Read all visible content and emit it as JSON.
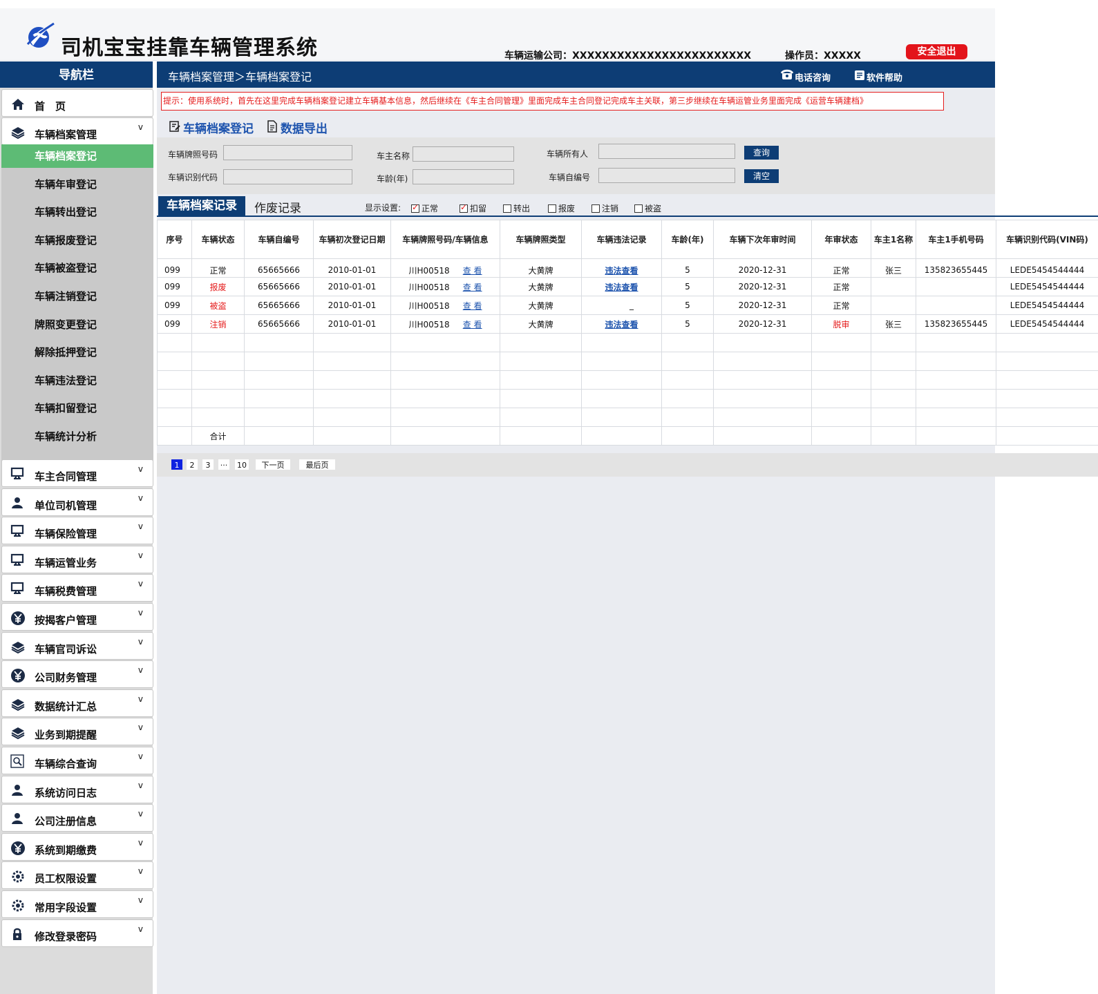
{
  "header": {
    "title": "司机宝宝挂靠车辆管理系统",
    "company": "车辆运输公司：XXXXXXXXXXXXXXXXXXXXXXXX",
    "operator": "操作员：XXXXX",
    "logout": "安全退出"
  },
  "sidebar": {
    "title": "导航栏",
    "home": "首　页",
    "archive_group": "车辆档案管理",
    "sub_items": [
      "车辆档案登记",
      "车辆年审登记",
      "车辆转出登记",
      "车辆报废登记",
      "车辆被盗登记",
      "车辆注销登记",
      "牌照变更登记",
      "解除抵押登记",
      "车辆违法登记",
      "车辆扣留登记",
      "车辆统计分析"
    ],
    "groups": [
      {
        "label": "车主合同管理",
        "icon": "monitor-icon"
      },
      {
        "label": "单位司机管理",
        "icon": "user-icon"
      },
      {
        "label": "车辆保险管理",
        "icon": "monitor-icon"
      },
      {
        "label": "车辆运管业务",
        "icon": "monitor-icon"
      },
      {
        "label": "车辆税费管理",
        "icon": "monitor-icon"
      },
      {
        "label": "按揭客户管理",
        "icon": "yen-icon"
      },
      {
        "label": "车辆官司诉讼",
        "icon": "layers-icon"
      },
      {
        "label": "公司财务管理",
        "icon": "yen-icon"
      },
      {
        "label": "数据统计汇总",
        "icon": "layers-icon"
      },
      {
        "label": "业务到期提醒",
        "icon": "layers-icon"
      },
      {
        "label": "车辆综合查询",
        "icon": "search-doc-icon"
      },
      {
        "label": "系统访问日志",
        "icon": "user-icon"
      },
      {
        "label": "公司注册信息",
        "icon": "user-icon"
      },
      {
        "label": "系统到期缴费",
        "icon": "yen-icon"
      },
      {
        "label": "员工权限设置",
        "icon": "gear-icon"
      },
      {
        "label": "常用字段设置",
        "icon": "gear-icon"
      },
      {
        "label": "修改登录密码",
        "icon": "lock-icon"
      }
    ],
    "chevron": "v"
  },
  "topbar": {
    "breadcrumb": "车辆档案管理＞车辆档案登记",
    "phone": "电话咨询",
    "help": "软件帮助"
  },
  "tip": "提示：使用系统时，首先在这里完成车辆档案登记建立车辆基本信息，然后继续在《车主合同管理》里面完成车主合同登记完成车主关联，第三步继续在车辆运管业务里面完成《运营车辆建档》",
  "actions": {
    "register": "车辆档案登记",
    "export": "数据导出"
  },
  "search": {
    "plate_label": "车辆牌照号码",
    "owner_name_label": "车主名称",
    "vehicle_owner_label": "车辆所有人",
    "vin_label": "车辆识别代码",
    "age_label": "车龄(年)",
    "self_no_label": "车辆自编号",
    "query_button": "查询",
    "clear_button": "清空"
  },
  "tabs": {
    "records": "车辆档案记录",
    "void": "作废记录"
  },
  "display": {
    "label": "显示设置:",
    "options": [
      {
        "label": "正常",
        "checked": true
      },
      {
        "label": "扣留",
        "checked": true
      },
      {
        "label": "转出",
        "checked": false
      },
      {
        "label": "报废",
        "checked": false
      },
      {
        "label": "注销",
        "checked": false
      },
      {
        "label": "被盗",
        "checked": false
      }
    ]
  },
  "table": {
    "headers": [
      "序号",
      "车辆状态",
      "车辆自编号",
      "车辆初次登记日期",
      "车辆牌照号码/车辆信息",
      "车辆牌照类型",
      "车辆违法记录",
      "车龄(年)",
      "车辆下次年审时间",
      "年审状态",
      "车主1名称",
      "车主1手机号码",
      "车辆识别代码(VIN码)"
    ],
    "rows": [
      {
        "no": "099",
        "status": "正常",
        "self_no": "65665666",
        "reg_date": "2010-01-01",
        "plate": "川H00518",
        "view": "查 看",
        "plate_type": "大黄牌",
        "violation": "违法查看",
        "age": "5",
        "next_review": "2020-12-31",
        "review_status": "正常",
        "owner": "张三",
        "phone": "135823655445",
        "vin": "LEDE5454544444"
      },
      {
        "no": "099",
        "status": "报废",
        "self_no": "65665666",
        "reg_date": "2010-01-01",
        "plate": "川H00518",
        "view": "查 看",
        "plate_type": "大黄牌",
        "violation": "违法查看",
        "age": "5",
        "next_review": "2020-12-31",
        "review_status": "正常",
        "owner": "",
        "phone": "",
        "vin": "LEDE5454544444"
      },
      {
        "no": "099",
        "status": "被盗",
        "self_no": "65665666",
        "reg_date": "2010-01-01",
        "plate": "川H00518",
        "view": "查 看",
        "plate_type": "大黄牌",
        "violation": "_",
        "age": "5",
        "next_review": "2020-12-31",
        "review_status": "正常",
        "owner": "",
        "phone": "",
        "vin": "LEDE5454544444"
      },
      {
        "no": "099",
        "status": "注销",
        "self_no": "65665666",
        "reg_date": "2010-01-01",
        "plate": "川H00518",
        "view": "查 看",
        "plate_type": "大黄牌",
        "violation": "违法查看",
        "age": "5",
        "next_review": "2020-12-31",
        "review_status": "脱审",
        "owner": "张三",
        "phone": "135823655445",
        "vin": "LEDE5454544444"
      }
    ],
    "total_label": "合计"
  },
  "pager": {
    "pages": [
      "1",
      "2",
      "3",
      "···",
      "10"
    ],
    "next": "下一页",
    "last": "最后页"
  },
  "colors": {
    "navy": "#0d3d75",
    "active_green": "#5dbb75",
    "alert_red": "#e51c1c",
    "link_blue": "#1e54ae"
  }
}
